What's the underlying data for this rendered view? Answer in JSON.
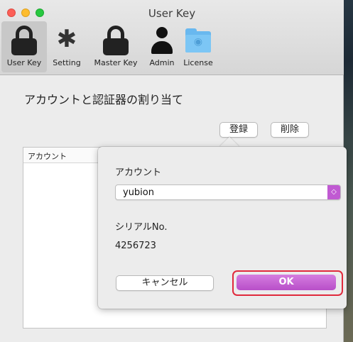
{
  "window": {
    "title": "User Key"
  },
  "toolbar": {
    "items": [
      {
        "label": "User Key",
        "icon": "lock-icon",
        "selected": true
      },
      {
        "label": "Setting",
        "icon": "gear-icon",
        "selected": false
      },
      {
        "label": "Master Key",
        "icon": "lock-icon",
        "selected": false
      },
      {
        "label": "Admin",
        "icon": "person-icon",
        "selected": false
      },
      {
        "label": "License",
        "icon": "folder-icon",
        "selected": false
      }
    ]
  },
  "main": {
    "title": "アカウントと認証器の割り当て",
    "register_label": "登録",
    "delete_label": "削除",
    "list_header": "アカウント"
  },
  "popover": {
    "account_label": "アカウント",
    "account_value": "yubion",
    "serial_label": "シリアルNo.",
    "serial_value": "4256723",
    "cancel_label": "キャンセル",
    "ok_label": "OK"
  },
  "colors": {
    "accent": "#c05ad2",
    "highlight": "#e02a3c"
  }
}
